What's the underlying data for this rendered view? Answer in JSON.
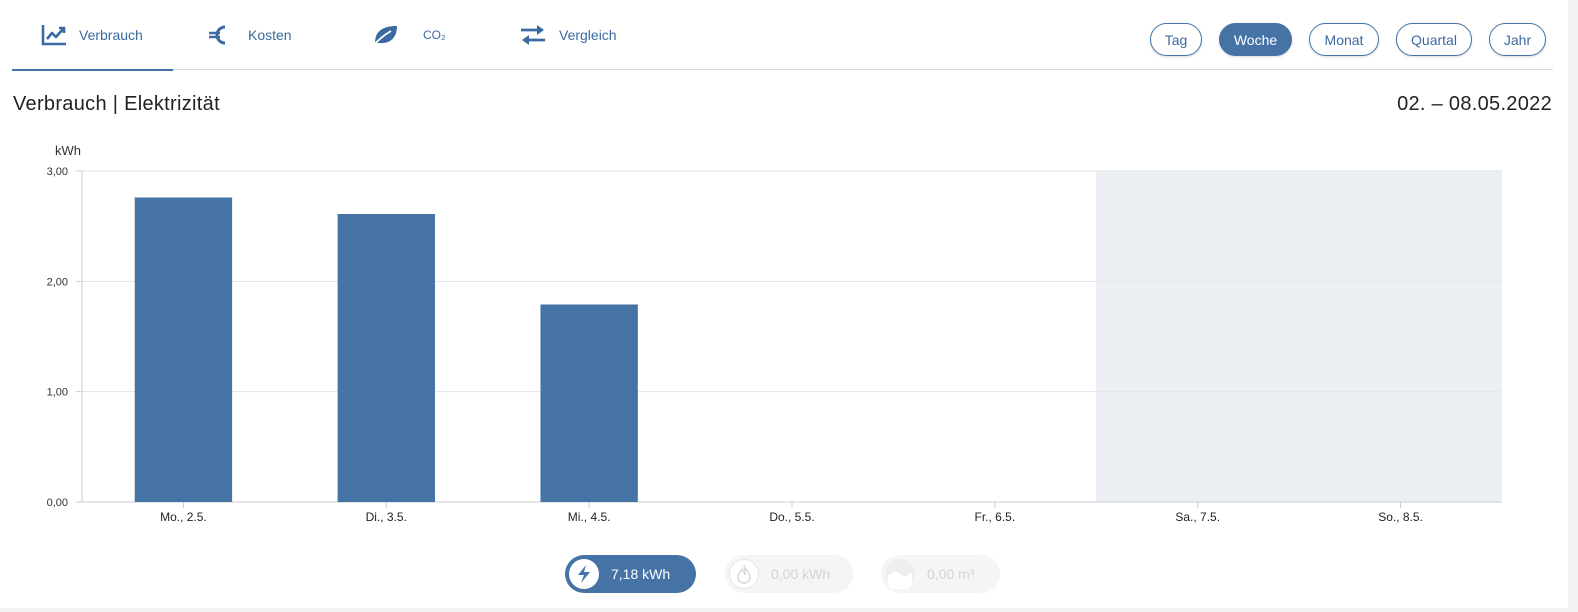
{
  "tabs": [
    {
      "label": "Verbrauch",
      "icon": "trend-chart-icon",
      "active": true
    },
    {
      "label": "Kosten",
      "icon": "euro-icon",
      "active": false
    },
    {
      "label": "CO₂",
      "icon": "leaf-icon",
      "active": false
    },
    {
      "label": "Vergleich",
      "icon": "swap-arrows-icon",
      "active": false
    }
  ],
  "periods": [
    {
      "label": "Tag",
      "active": false
    },
    {
      "label": "Woche",
      "active": true
    },
    {
      "label": "Monat",
      "active": false
    },
    {
      "label": "Quartal",
      "active": false
    },
    {
      "label": "Jahr",
      "active": false
    }
  ],
  "header": {
    "title": "Verbrauch | Elektrizität",
    "date_range": "02. – 08.05.2022"
  },
  "colors": {
    "accent": "#4573a5",
    "bar": "#4573a5",
    "weekend_shade": "#ebeef2",
    "gridline": "#e3e6ea"
  },
  "chart_data": {
    "type": "bar",
    "ylabel": "kWh",
    "categories": [
      "Mo., 2.5.",
      "Di., 3.5.",
      "Mi., 4.5.",
      "Do., 5.5.",
      "Fr., 6.5.",
      "Sa., 7.5.",
      "So., 8.5."
    ],
    "values": [
      2.76,
      2.61,
      1.79,
      0,
      0,
      0,
      0
    ],
    "ylim": [
      0,
      3
    ],
    "yticks": [
      "0,00",
      "1,00",
      "2,00",
      "3,00"
    ],
    "grid": true,
    "shaded_categories": [
      "Sa., 7.5.",
      "So., 8.5."
    ]
  },
  "summary": {
    "electricity": {
      "value": "7,18 kWh",
      "icon": "lightning-icon"
    },
    "gas": {
      "value": "0,00 kWh",
      "icon": "flame-icon"
    },
    "water": {
      "value": "0,00 m³",
      "icon": "water-wave-icon"
    }
  }
}
